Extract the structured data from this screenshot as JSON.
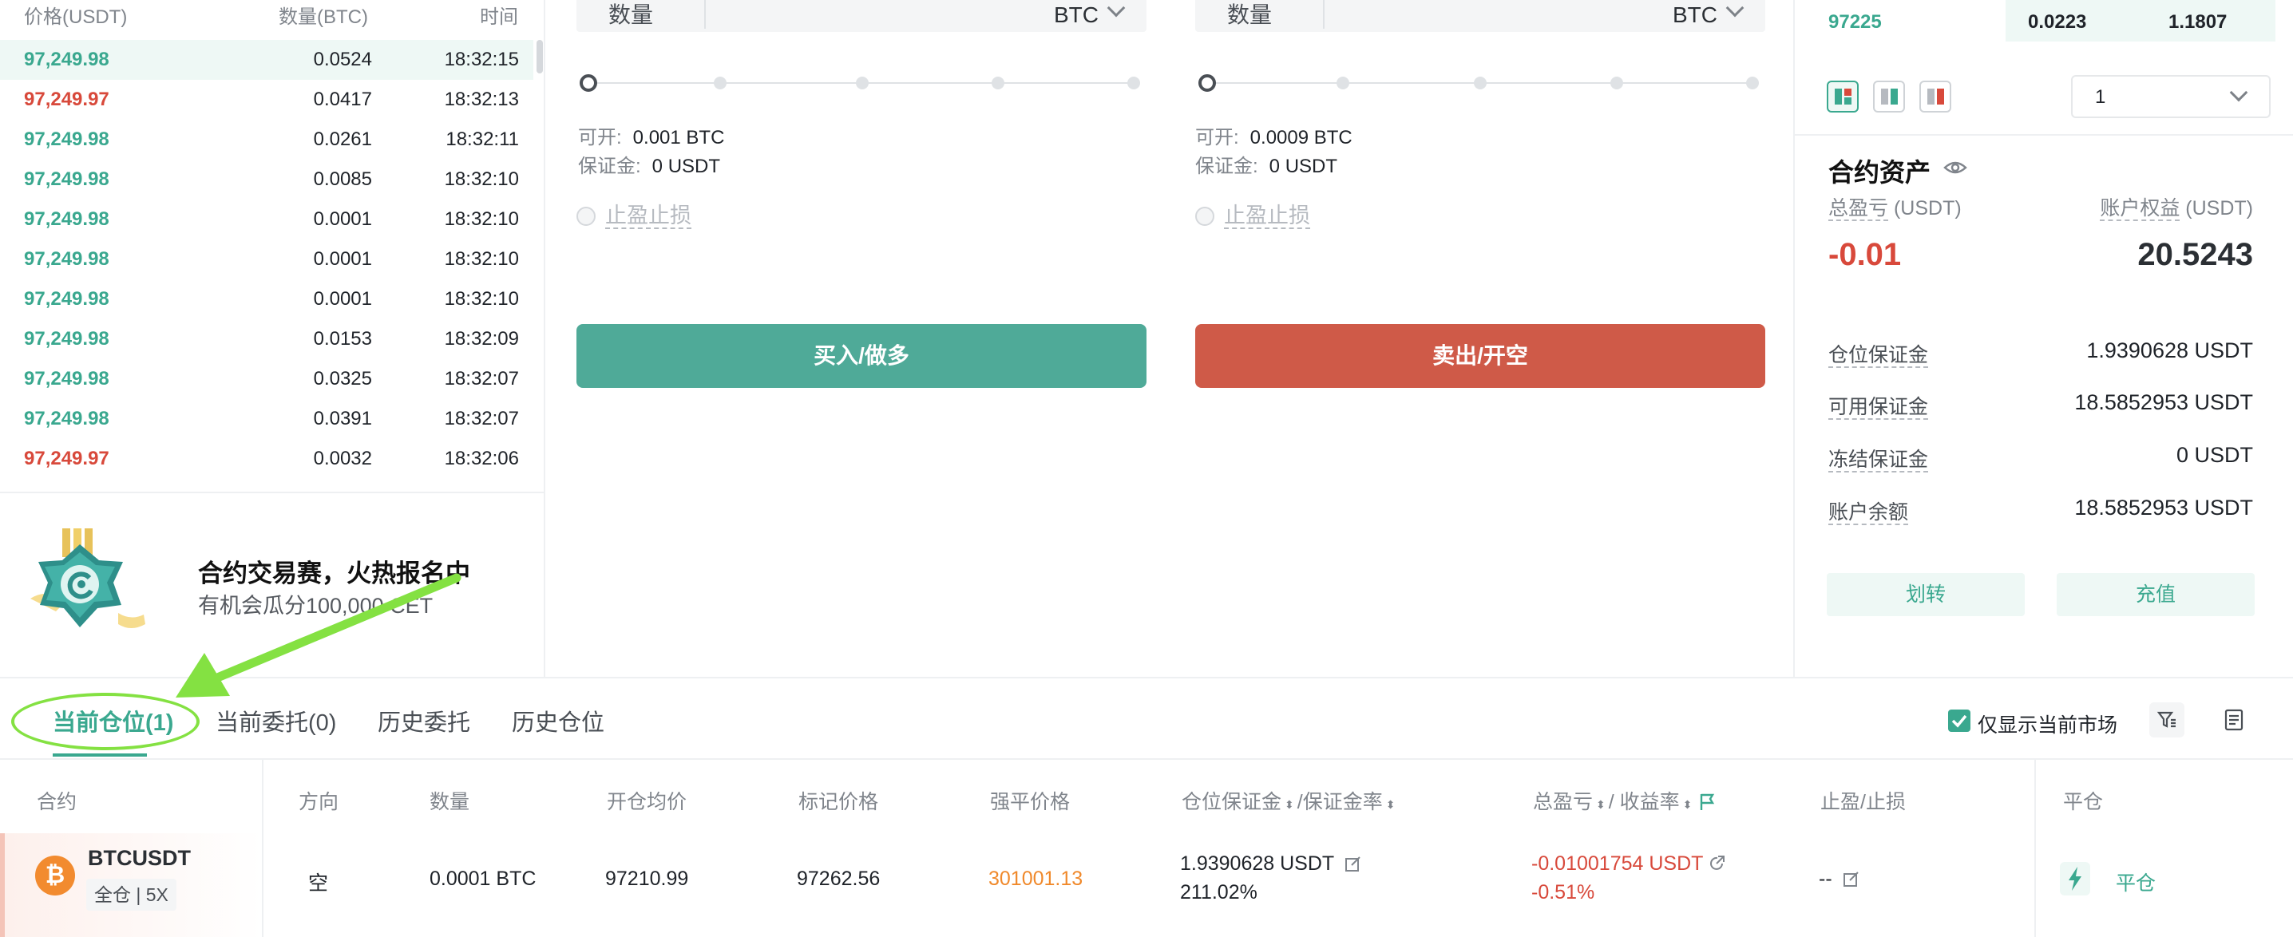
{
  "trades": {
    "headers": {
      "price": "价格(USDT)",
      "qty": "数量(BTC)",
      "time": "时间"
    },
    "rows": [
      {
        "price": "97,249.98",
        "qty": "0.0524",
        "time": "18:32:15",
        "side": "up"
      },
      {
        "price": "97,249.97",
        "qty": "0.0417",
        "time": "18:32:13",
        "side": "dn"
      },
      {
        "price": "97,249.98",
        "qty": "0.0261",
        "time": "18:32:11",
        "side": "up"
      },
      {
        "price": "97,249.98",
        "qty": "0.0085",
        "time": "18:32:10",
        "side": "up"
      },
      {
        "price": "97,249.98",
        "qty": "0.0001",
        "time": "18:32:10",
        "side": "up"
      },
      {
        "price": "97,249.98",
        "qty": "0.0001",
        "time": "18:32:10",
        "side": "up"
      },
      {
        "price": "97,249.98",
        "qty": "0.0001",
        "time": "18:32:10",
        "side": "up"
      },
      {
        "price": "97,249.98",
        "qty": "0.0153",
        "time": "18:32:09",
        "side": "up"
      },
      {
        "price": "97,249.98",
        "qty": "0.0325",
        "time": "18:32:07",
        "side": "up"
      },
      {
        "price": "97,249.98",
        "qty": "0.0391",
        "time": "18:32:07",
        "side": "up"
      },
      {
        "price": "97,249.97",
        "qty": "0.0032",
        "time": "18:32:06",
        "side": "dn"
      }
    ]
  },
  "banner": {
    "title": "合约交易赛，火热报名中",
    "subtitle": "有机会瓜分100,000 CET"
  },
  "buy_form": {
    "qty_label": "数量",
    "unit": "BTC",
    "available_label": "可开:",
    "available_value": "0.001 BTC",
    "margin_label": "保证金:",
    "margin_value": "0 USDT",
    "tpsl_label": "止盈止损",
    "submit_label": "买入/做多"
  },
  "sell_form": {
    "qty_label": "数量",
    "unit": "BTC",
    "available_label": "可开:",
    "available_value": "0.0009 BTC",
    "margin_label": "保证金:",
    "margin_value": "0 USDT",
    "tpsl_label": "止盈止损",
    "submit_label": "卖出/开空"
  },
  "orderbook_row": {
    "price": "97225",
    "qty": "0.0223",
    "total": "1.1807"
  },
  "depth_select": {
    "value": "1"
  },
  "assets": {
    "title": "合约资产",
    "pnl_label": "总盈亏",
    "pnl_unit": "(USDT)",
    "equity_label": "账户权益",
    "equity_unit": "(USDT)",
    "pnl_value": "-0.01",
    "equity_value": "20.5243",
    "rows": [
      {
        "label": "仓位保证金",
        "value": "1.9390628 USDT"
      },
      {
        "label": "可用保证金",
        "value": "18.5852953 USDT"
      },
      {
        "label": "冻结保证金",
        "value": "0 USDT"
      },
      {
        "label": "账户余额",
        "value": "18.5852953 USDT"
      }
    ],
    "transfer_label": "划转",
    "deposit_label": "充值"
  },
  "tabs": [
    {
      "label": "当前仓位(1)"
    },
    {
      "label": "当前委托(0)"
    },
    {
      "label": "历史委托"
    },
    {
      "label": "历史仓位"
    }
  ],
  "filter": {
    "label": "仅显示当前市场",
    "checked": true
  },
  "columns": {
    "contract": "合约",
    "direction": "方向",
    "qty": "数量",
    "entry": "开仓均价",
    "mark": "标记价格",
    "liq": "强平价格",
    "margin": "仓位保证金",
    "margin_rate": "/保证金率",
    "pnl": "总盈亏",
    "roe": "/ 收益率",
    "tpsl": "止盈/止损",
    "close": "平仓"
  },
  "position": {
    "logo": "₿",
    "symbol": "BTCUSDT",
    "tag": "全仓 | 5X",
    "direction": "空",
    "qty": "0.0001 BTC",
    "entry": "97210.99",
    "mark": "97262.56",
    "liq": "301001.13",
    "margin": "1.9390628 USDT",
    "margin_rate": "211.02%",
    "pnl": "-0.01001754 USDT",
    "roe": "-0.51%",
    "tpsl": "--",
    "close_label": "平仓"
  },
  "colors": {
    "accent": "#3aa88f",
    "buy": "#4faa98",
    "sell": "#cf5a48",
    "loss": "#d8493b",
    "liq": "#f0892b",
    "annotation": "#84e142"
  }
}
